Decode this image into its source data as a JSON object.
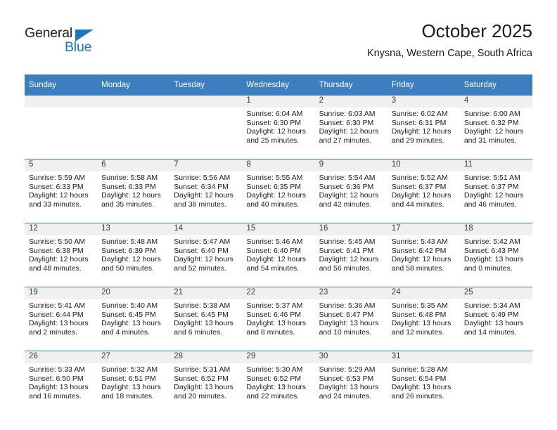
{
  "brand": {
    "name_top": "General",
    "name_bottom": "Blue",
    "accent_color": "#1b76bc"
  },
  "header": {
    "title": "October 2025",
    "subtitle": "Knysna, Western Cape, South Africa"
  },
  "calendar": {
    "header_bg": "#3c7ebf",
    "day_band_bg": "#f0f0f0",
    "weekday_headers": [
      "Sunday",
      "Monday",
      "Tuesday",
      "Wednesday",
      "Thursday",
      "Friday",
      "Saturday"
    ],
    "labels": {
      "sunrise": "Sunrise:",
      "sunset": "Sunset:",
      "daylight": "Daylight:"
    },
    "weeks": [
      [
        {
          "blank": true
        },
        {
          "blank": true
        },
        {
          "blank": true
        },
        {
          "day": "1",
          "sunrise": "Sunrise: 6:04 AM",
          "sunset": "Sunset: 6:30 PM",
          "daylight_line1": "Daylight: 12 hours",
          "daylight_line2": "and 25 minutes."
        },
        {
          "day": "2",
          "sunrise": "Sunrise: 6:03 AM",
          "sunset": "Sunset: 6:30 PM",
          "daylight_line1": "Daylight: 12 hours",
          "daylight_line2": "and 27 minutes."
        },
        {
          "day": "3",
          "sunrise": "Sunrise: 6:02 AM",
          "sunset": "Sunset: 6:31 PM",
          "daylight_line1": "Daylight: 12 hours",
          "daylight_line2": "and 29 minutes."
        },
        {
          "day": "4",
          "sunrise": "Sunrise: 6:00 AM",
          "sunset": "Sunset: 6:32 PM",
          "daylight_line1": "Daylight: 12 hours",
          "daylight_line2": "and 31 minutes."
        }
      ],
      [
        {
          "day": "5",
          "sunrise": "Sunrise: 5:59 AM",
          "sunset": "Sunset: 6:33 PM",
          "daylight_line1": "Daylight: 12 hours",
          "daylight_line2": "and 33 minutes."
        },
        {
          "day": "6",
          "sunrise": "Sunrise: 5:58 AM",
          "sunset": "Sunset: 6:33 PM",
          "daylight_line1": "Daylight: 12 hours",
          "daylight_line2": "and 35 minutes."
        },
        {
          "day": "7",
          "sunrise": "Sunrise: 5:56 AM",
          "sunset": "Sunset: 6:34 PM",
          "daylight_line1": "Daylight: 12 hours",
          "daylight_line2": "and 38 minutes."
        },
        {
          "day": "8",
          "sunrise": "Sunrise: 5:55 AM",
          "sunset": "Sunset: 6:35 PM",
          "daylight_line1": "Daylight: 12 hours",
          "daylight_line2": "and 40 minutes."
        },
        {
          "day": "9",
          "sunrise": "Sunrise: 5:54 AM",
          "sunset": "Sunset: 6:36 PM",
          "daylight_line1": "Daylight: 12 hours",
          "daylight_line2": "and 42 minutes."
        },
        {
          "day": "10",
          "sunrise": "Sunrise: 5:52 AM",
          "sunset": "Sunset: 6:37 PM",
          "daylight_line1": "Daylight: 12 hours",
          "daylight_line2": "and 44 minutes."
        },
        {
          "day": "11",
          "sunrise": "Sunrise: 5:51 AM",
          "sunset": "Sunset: 6:37 PM",
          "daylight_line1": "Daylight: 12 hours",
          "daylight_line2": "and 46 minutes."
        }
      ],
      [
        {
          "day": "12",
          "sunrise": "Sunrise: 5:50 AM",
          "sunset": "Sunset: 6:38 PM",
          "daylight_line1": "Daylight: 12 hours",
          "daylight_line2": "and 48 minutes."
        },
        {
          "day": "13",
          "sunrise": "Sunrise: 5:48 AM",
          "sunset": "Sunset: 6:39 PM",
          "daylight_line1": "Daylight: 12 hours",
          "daylight_line2": "and 50 minutes."
        },
        {
          "day": "14",
          "sunrise": "Sunrise: 5:47 AM",
          "sunset": "Sunset: 6:40 PM",
          "daylight_line1": "Daylight: 12 hours",
          "daylight_line2": "and 52 minutes."
        },
        {
          "day": "15",
          "sunrise": "Sunrise: 5:46 AM",
          "sunset": "Sunset: 6:40 PM",
          "daylight_line1": "Daylight: 12 hours",
          "daylight_line2": "and 54 minutes."
        },
        {
          "day": "16",
          "sunrise": "Sunrise: 5:45 AM",
          "sunset": "Sunset: 6:41 PM",
          "daylight_line1": "Daylight: 12 hours",
          "daylight_line2": "and 56 minutes."
        },
        {
          "day": "17",
          "sunrise": "Sunrise: 5:43 AM",
          "sunset": "Sunset: 6:42 PM",
          "daylight_line1": "Daylight: 12 hours",
          "daylight_line2": "and 58 minutes."
        },
        {
          "day": "18",
          "sunrise": "Sunrise: 5:42 AM",
          "sunset": "Sunset: 6:43 PM",
          "daylight_line1": "Daylight: 13 hours",
          "daylight_line2": "and 0 minutes."
        }
      ],
      [
        {
          "day": "19",
          "sunrise": "Sunrise: 5:41 AM",
          "sunset": "Sunset: 6:44 PM",
          "daylight_line1": "Daylight: 13 hours",
          "daylight_line2": "and 2 minutes."
        },
        {
          "day": "20",
          "sunrise": "Sunrise: 5:40 AM",
          "sunset": "Sunset: 6:45 PM",
          "daylight_line1": "Daylight: 13 hours",
          "daylight_line2": "and 4 minutes."
        },
        {
          "day": "21",
          "sunrise": "Sunrise: 5:38 AM",
          "sunset": "Sunset: 6:45 PM",
          "daylight_line1": "Daylight: 13 hours",
          "daylight_line2": "and 6 minutes."
        },
        {
          "day": "22",
          "sunrise": "Sunrise: 5:37 AM",
          "sunset": "Sunset: 6:46 PM",
          "daylight_line1": "Daylight: 13 hours",
          "daylight_line2": "and 8 minutes."
        },
        {
          "day": "23",
          "sunrise": "Sunrise: 5:36 AM",
          "sunset": "Sunset: 6:47 PM",
          "daylight_line1": "Daylight: 13 hours",
          "daylight_line2": "and 10 minutes."
        },
        {
          "day": "24",
          "sunrise": "Sunrise: 5:35 AM",
          "sunset": "Sunset: 6:48 PM",
          "daylight_line1": "Daylight: 13 hours",
          "daylight_line2": "and 12 minutes."
        },
        {
          "day": "25",
          "sunrise": "Sunrise: 5:34 AM",
          "sunset": "Sunset: 6:49 PM",
          "daylight_line1": "Daylight: 13 hours",
          "daylight_line2": "and 14 minutes."
        }
      ],
      [
        {
          "day": "26",
          "sunrise": "Sunrise: 5:33 AM",
          "sunset": "Sunset: 6:50 PM",
          "daylight_line1": "Daylight: 13 hours",
          "daylight_line2": "and 16 minutes."
        },
        {
          "day": "27",
          "sunrise": "Sunrise: 5:32 AM",
          "sunset": "Sunset: 6:51 PM",
          "daylight_line1": "Daylight: 13 hours",
          "daylight_line2": "and 18 minutes."
        },
        {
          "day": "28",
          "sunrise": "Sunrise: 5:31 AM",
          "sunset": "Sunset: 6:52 PM",
          "daylight_line1": "Daylight: 13 hours",
          "daylight_line2": "and 20 minutes."
        },
        {
          "day": "29",
          "sunrise": "Sunrise: 5:30 AM",
          "sunset": "Sunset: 6:52 PM",
          "daylight_line1": "Daylight: 13 hours",
          "daylight_line2": "and 22 minutes."
        },
        {
          "day": "30",
          "sunrise": "Sunrise: 5:29 AM",
          "sunset": "Sunset: 6:53 PM",
          "daylight_line1": "Daylight: 13 hours",
          "daylight_line2": "and 24 minutes."
        },
        {
          "day": "31",
          "sunrise": "Sunrise: 5:28 AM",
          "sunset": "Sunset: 6:54 PM",
          "daylight_line1": "Daylight: 13 hours",
          "daylight_line2": "and 26 minutes."
        },
        {
          "blank": true
        }
      ]
    ]
  }
}
